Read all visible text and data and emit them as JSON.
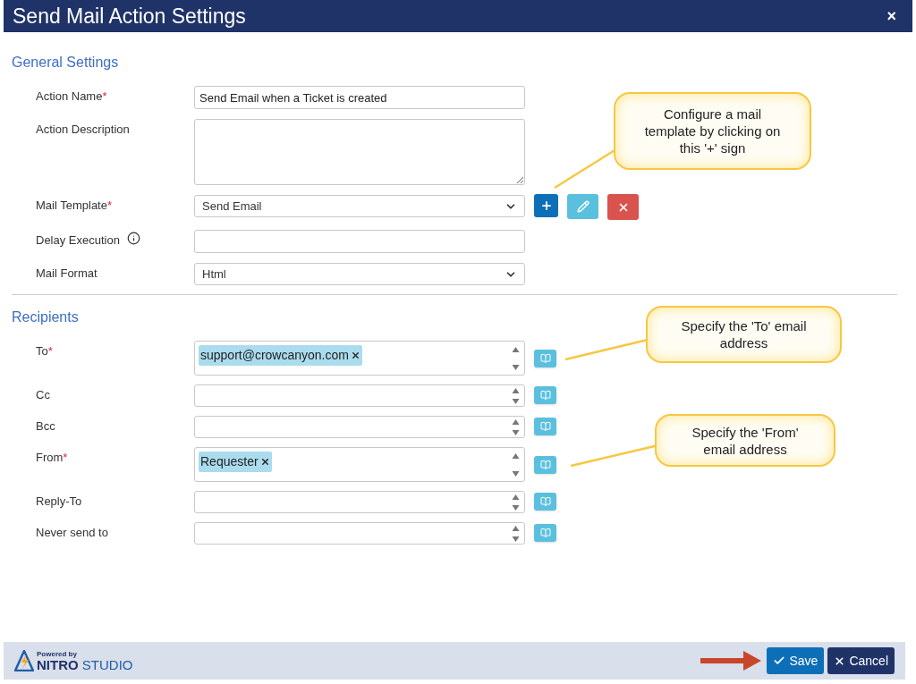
{
  "window": {
    "title": "Send Mail Action Settings",
    "close": "×"
  },
  "general_settings": {
    "heading": "General Settings",
    "fields": [
      {
        "label": "Action Name",
        "required_mark": "*",
        "kind": "text",
        "value": "Send Email when a Ticket is created"
      },
      {
        "label": "Action Description",
        "kind": "textarea"
      },
      {
        "label": "Mail Template",
        "required_mark": "*",
        "kind": "select",
        "value": "Send Email",
        "actions": true
      },
      {
        "label": "Delay Execution",
        "kind": "text",
        "info": true
      },
      {
        "label": "Mail Format",
        "kind": "select",
        "value": "Html"
      }
    ]
  },
  "recipients": {
    "heading": "Recipients",
    "fields": [
      {
        "label": "To",
        "required_mark": "*",
        "tokens": [
          "support@crowcanyon.com"
        ]
      },
      {
        "label": "Cc"
      },
      {
        "label": "Bcc"
      },
      {
        "label": "From",
        "required_mark": "*",
        "tokens": [
          "Requester"
        ]
      },
      {
        "label": "Reply-To"
      },
      {
        "label": "Never send to"
      }
    ]
  },
  "callouts": [
    {
      "text": "Configure a mail template by clicking on this '+' sign"
    },
    {
      "text": "Specify the 'To' email address"
    },
    {
      "text": "Specify the 'From' email address"
    }
  ],
  "footer": {
    "powered_by": "Powered by",
    "brand_bold": "NITRO",
    "brand": "STUDIO",
    "buttons": [
      {
        "label": "Save",
        "kind": "primary"
      },
      {
        "label": "Cancel",
        "kind": "secondary"
      }
    ]
  }
}
